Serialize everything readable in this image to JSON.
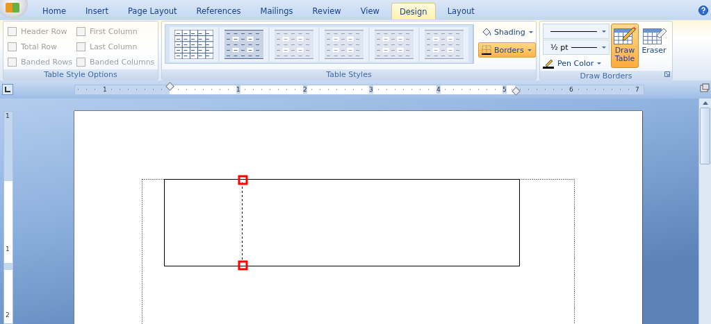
{
  "tabs": [
    {
      "label": "Home",
      "selected": false
    },
    {
      "label": "Insert",
      "selected": false
    },
    {
      "label": "Page Layout",
      "selected": false
    },
    {
      "label": "References",
      "selected": false
    },
    {
      "label": "Mailings",
      "selected": false
    },
    {
      "label": "Review",
      "selected": false
    },
    {
      "label": "View",
      "selected": false
    },
    {
      "label": "Design",
      "selected": true
    },
    {
      "label": "Layout",
      "selected": false
    }
  ],
  "table_style_options": {
    "label": "Table Style Options",
    "options": [
      {
        "label": "Header Row",
        "checked": false,
        "disabled": true
      },
      {
        "label": "First Column",
        "checked": false,
        "disabled": true
      },
      {
        "label": "Total Row",
        "checked": false,
        "disabled": true
      },
      {
        "label": "Last Column",
        "checked": false,
        "disabled": true
      },
      {
        "label": "Banded Rows",
        "checked": false,
        "disabled": true
      },
      {
        "label": "Banded Columns",
        "checked": false,
        "disabled": true
      }
    ]
  },
  "table_styles": {
    "label": "Table Styles",
    "gallery": [
      {
        "kind": "grid"
      },
      {
        "kind": "dark"
      },
      {
        "kind": "light"
      },
      {
        "kind": "light"
      },
      {
        "kind": "light"
      },
      {
        "kind": "light"
      }
    ],
    "buttons": [
      {
        "label": "Shading",
        "selected": false
      },
      {
        "label": "Borders",
        "selected": true
      }
    ]
  },
  "draw_borders": {
    "label": "Draw Borders",
    "weight": "½ pt",
    "pen_color": "Pen Color",
    "tools": [
      {
        "label": "Draw Table",
        "kind": "pencil",
        "selected": true
      },
      {
        "label": "Eraser",
        "kind": "eraser",
        "selected": false
      }
    ]
  },
  "horizontal_ruler": [
    "1",
    "1",
    "2",
    "3",
    "4",
    "5",
    "6",
    "7"
  ],
  "vertical_ruler": [
    "1",
    "1",
    "2"
  ]
}
